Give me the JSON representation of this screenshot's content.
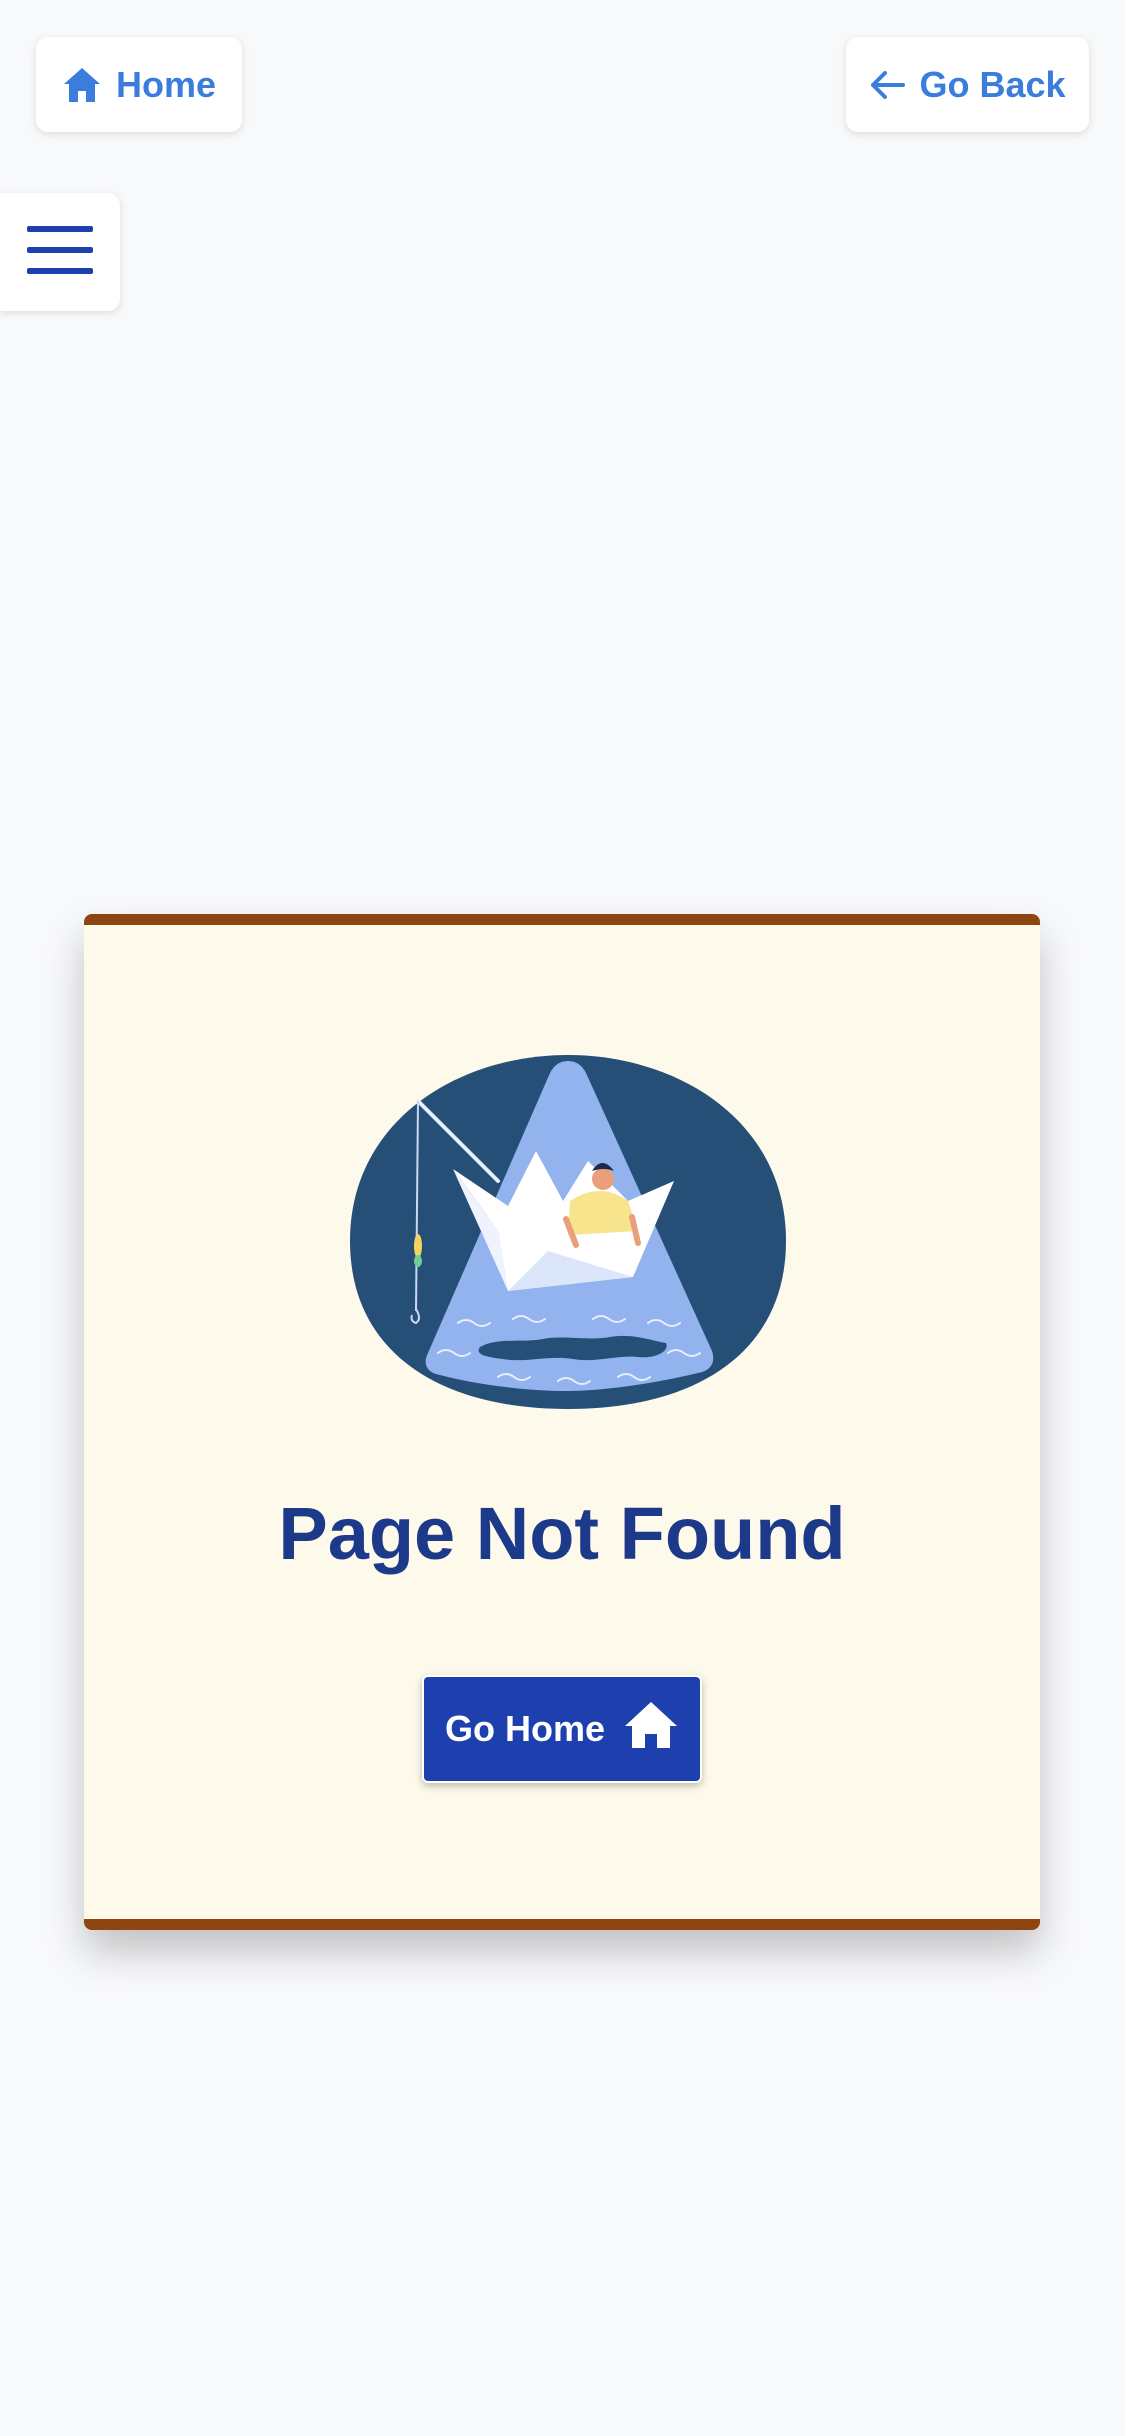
{
  "nav": {
    "home_label": "Home",
    "back_label": "Go Back"
  },
  "error_card": {
    "title": "Page Not Found",
    "go_home_label": "Go Home"
  },
  "icons": {
    "home": "home-icon",
    "back": "arrow-left-icon",
    "menu": "hamburger-menu-icon",
    "button_home": "house-icon"
  },
  "colors": {
    "accent": "#3b7ddd",
    "primary_button": "#1e40af",
    "title": "#1d3a8a",
    "card_background": "#fdf9eb",
    "card_border": "#8f4511",
    "page_background": "#f8f9fb"
  }
}
